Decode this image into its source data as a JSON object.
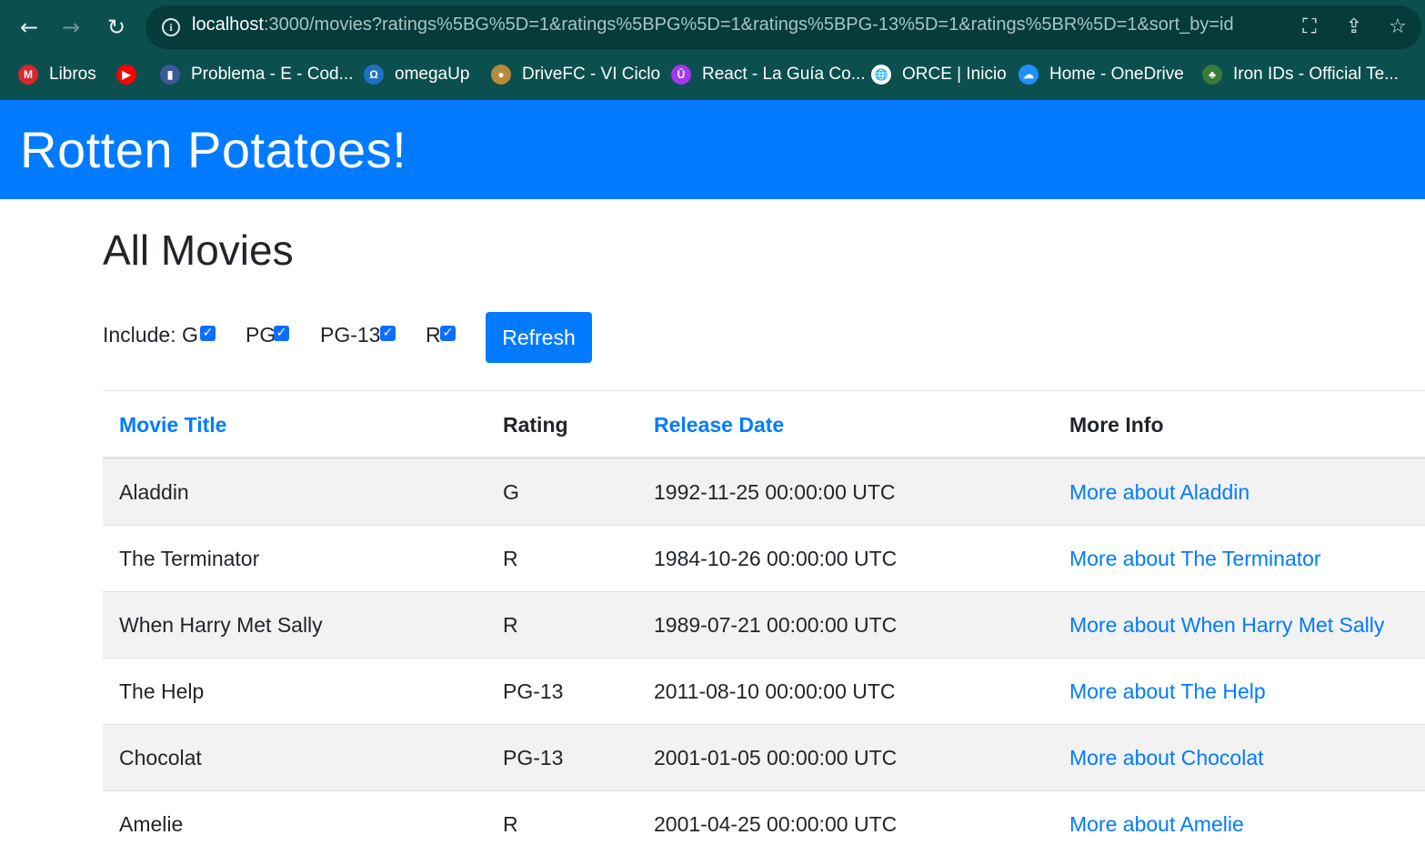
{
  "browser": {
    "url_host": "localhost",
    "url_rest": ":3000/movies?ratings%5BG%5D=1&ratings%5BPG%5D=1&ratings%5BPG-13%5D=1&ratings%5BR%5D=1&sort_by=id",
    "bookmarks": [
      {
        "label": "Libros",
        "icon": "mega-icon",
        "color": "#d9272e",
        "glyph": "M"
      },
      {
        "label": "",
        "icon": "youtube-icon",
        "color": "#ff0000",
        "glyph": "▶"
      },
      {
        "label": "Problema - E - Cod...",
        "icon": "codeforces-icon",
        "color": "#3b5998",
        "glyph": "▮"
      },
      {
        "label": "omegaUp",
        "icon": "omegaup-icon",
        "color": "#1f6fc5",
        "glyph": "Ω"
      },
      {
        "label": "DriveFC - VI Ciclo",
        "icon": "drivefc-icon",
        "color": "#b58a3a",
        "glyph": "●"
      },
      {
        "label": "React - La Guía Co...",
        "icon": "udemy-icon",
        "color": "#a435f0",
        "glyph": "Û"
      },
      {
        "label": "ORCE | Inicio",
        "icon": "globe-icon",
        "color": "#ffffff",
        "glyph": "🌐"
      },
      {
        "label": "Home - OneDrive",
        "icon": "onedrive-icon",
        "color": "#1e90ff",
        "glyph": "☁"
      },
      {
        "label": "Iron IDs - Official Te...",
        "icon": "ironids-icon",
        "color": "#3a7a3a",
        "glyph": "♣"
      }
    ]
  },
  "app": {
    "brand": "Rotten Potatoes!",
    "page_title": "All Movies",
    "filters": {
      "include_label": "Include:",
      "ratings": [
        {
          "label": "G",
          "checked": true
        },
        {
          "label": "PG",
          "checked": true
        },
        {
          "label": "PG-13",
          "checked": true
        },
        {
          "label": "R",
          "checked": true
        }
      ],
      "refresh_label": "Refresh"
    },
    "table": {
      "headers": [
        "Movie Title",
        "Rating",
        "Release Date",
        "More Info"
      ],
      "rows": [
        {
          "title": "Aladdin",
          "rating": "G",
          "release": "1992-11-25 00:00:00 UTC",
          "more": "More about Aladdin"
        },
        {
          "title": "The Terminator",
          "rating": "R",
          "release": "1984-10-26 00:00:00 UTC",
          "more": "More about The Terminator"
        },
        {
          "title": "When Harry Met Sally",
          "rating": "R",
          "release": "1989-07-21 00:00:00 UTC",
          "more": "More about When Harry Met Sally"
        },
        {
          "title": "The Help",
          "rating": "PG-13",
          "release": "2011-08-10 00:00:00 UTC",
          "more": "More about The Help"
        },
        {
          "title": "Chocolat",
          "rating": "PG-13",
          "release": "2001-01-05 00:00:00 UTC",
          "more": "More about Chocolat"
        },
        {
          "title": "Amelie",
          "rating": "R",
          "release": "2001-04-25 00:00:00 UTC",
          "more": "More about Amelie"
        }
      ]
    }
  },
  "colors": {
    "accent": "#007bff",
    "chrome": "#0b4f4f"
  }
}
